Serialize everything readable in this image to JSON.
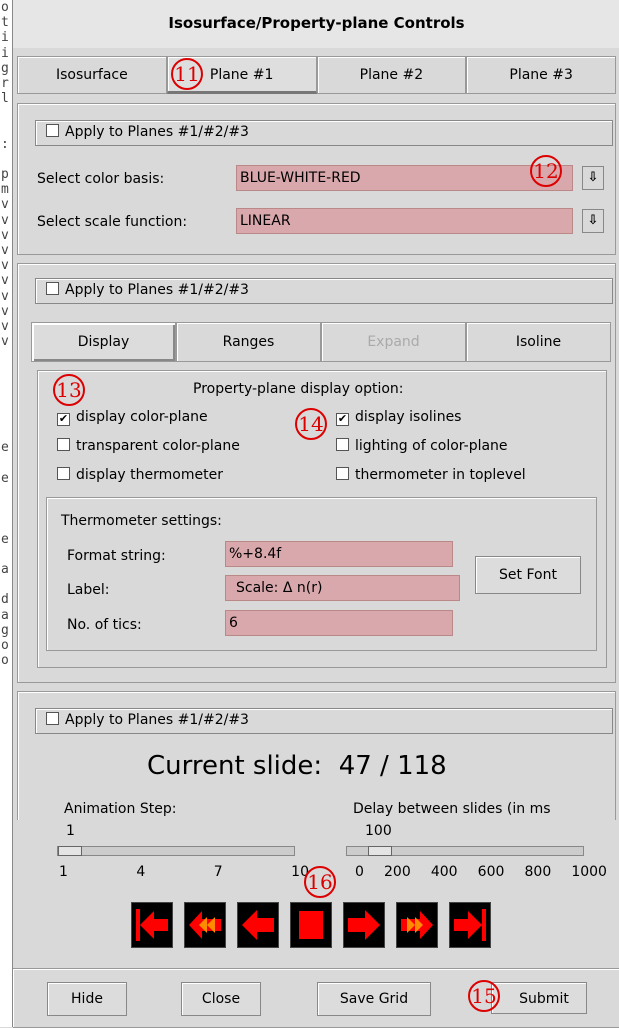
{
  "background_text": [
    "o",
    "t",
    "i",
    "i",
    "g",
    "r",
    "l",
    "",
    "",
    ":",
    "",
    "p",
    "m",
    "v",
    "v",
    "v",
    "v",
    "v",
    "v",
    "v",
    "v",
    "v",
    "v",
    "",
    "",
    "",
    "",
    "",
    "",
    "e",
    "",
    "e",
    "",
    "",
    "",
    "e",
    "",
    "a",
    "",
    "d",
    "a",
    "g",
    "o",
    "o"
  ],
  "window": {
    "title": "Isosurface/Property-plane Controls"
  },
  "tabs": [
    {
      "label": "Isosurface"
    },
    {
      "label": "Plane #1"
    },
    {
      "label": "Plane #2"
    },
    {
      "label": "Plane #3"
    }
  ],
  "color_section": {
    "apply_label": "Apply to Planes #1/#2/#3",
    "color_basis_label": "Select color basis:",
    "color_basis_value": "BLUE-WHITE-RED",
    "scale_function_label": "Select scale function:",
    "scale_function_value": "LINEAR",
    "dropdown_glyph": "⇩"
  },
  "display_section": {
    "apply_label": "Apply to Planes #1/#2/#3",
    "subtabs": [
      {
        "label": "Display",
        "state": "active"
      },
      {
        "label": "Ranges",
        "state": "normal"
      },
      {
        "label": "Expand",
        "state": "disabled"
      },
      {
        "label": "Isoline",
        "state": "normal"
      }
    ],
    "options_title": "Property-plane display option:",
    "options": {
      "display_color_plane": {
        "label": "display color-plane",
        "checked": true
      },
      "transparent_color_plane": {
        "label": "transparent color-plane",
        "checked": false
      },
      "display_thermometer": {
        "label": "display thermometer",
        "checked": false
      },
      "display_isolines": {
        "label": "display isolines",
        "checked": true
      },
      "lighting": {
        "label": "lighting of color-plane",
        "checked": false
      },
      "thermometer_toplevel": {
        "label": "thermometer in toplevel",
        "checked": false
      }
    },
    "thermometer": {
      "title": "Thermometer settings:",
      "format_label": "Format string:",
      "format_value": "%+8.4f",
      "label_label": "Label:",
      "label_value": "Scale:  Δ n(r)",
      "tics_label": "No. of tics:",
      "tics_value": "6",
      "set_font_button": "Set Font"
    }
  },
  "animation_section": {
    "apply_label": "Apply to Planes #1/#2/#3",
    "current_slide_label": "Current slide:",
    "current_slide_value": "47 / 118",
    "step_label": "Animation Step:",
    "step_value": "1",
    "step_fraction": 0.0,
    "step_ticks": [
      "1",
      "4",
      "7",
      "10"
    ],
    "delay_label": "Delay between slides (in ms",
    "delay_value": "100",
    "delay_fraction": 0.1,
    "delay_ticks": [
      "0",
      "200",
      "400",
      "600",
      "800",
      "1000"
    ],
    "buttons": [
      "first-frame",
      "fast-backward",
      "backward",
      "stop",
      "forward",
      "fast-forward",
      "last-frame"
    ],
    "accent_red": "#ff0000",
    "accent_orange": "#ff8c00"
  },
  "footer": {
    "hide": "Hide",
    "close": "Close",
    "save_grid": "Save Grid",
    "submit": "Submit"
  },
  "annotations": {
    "a11": "11",
    "a12": "12",
    "a13": "13",
    "a14": "14",
    "a15": "15",
    "a16": "16",
    "color": "#dd0000"
  }
}
